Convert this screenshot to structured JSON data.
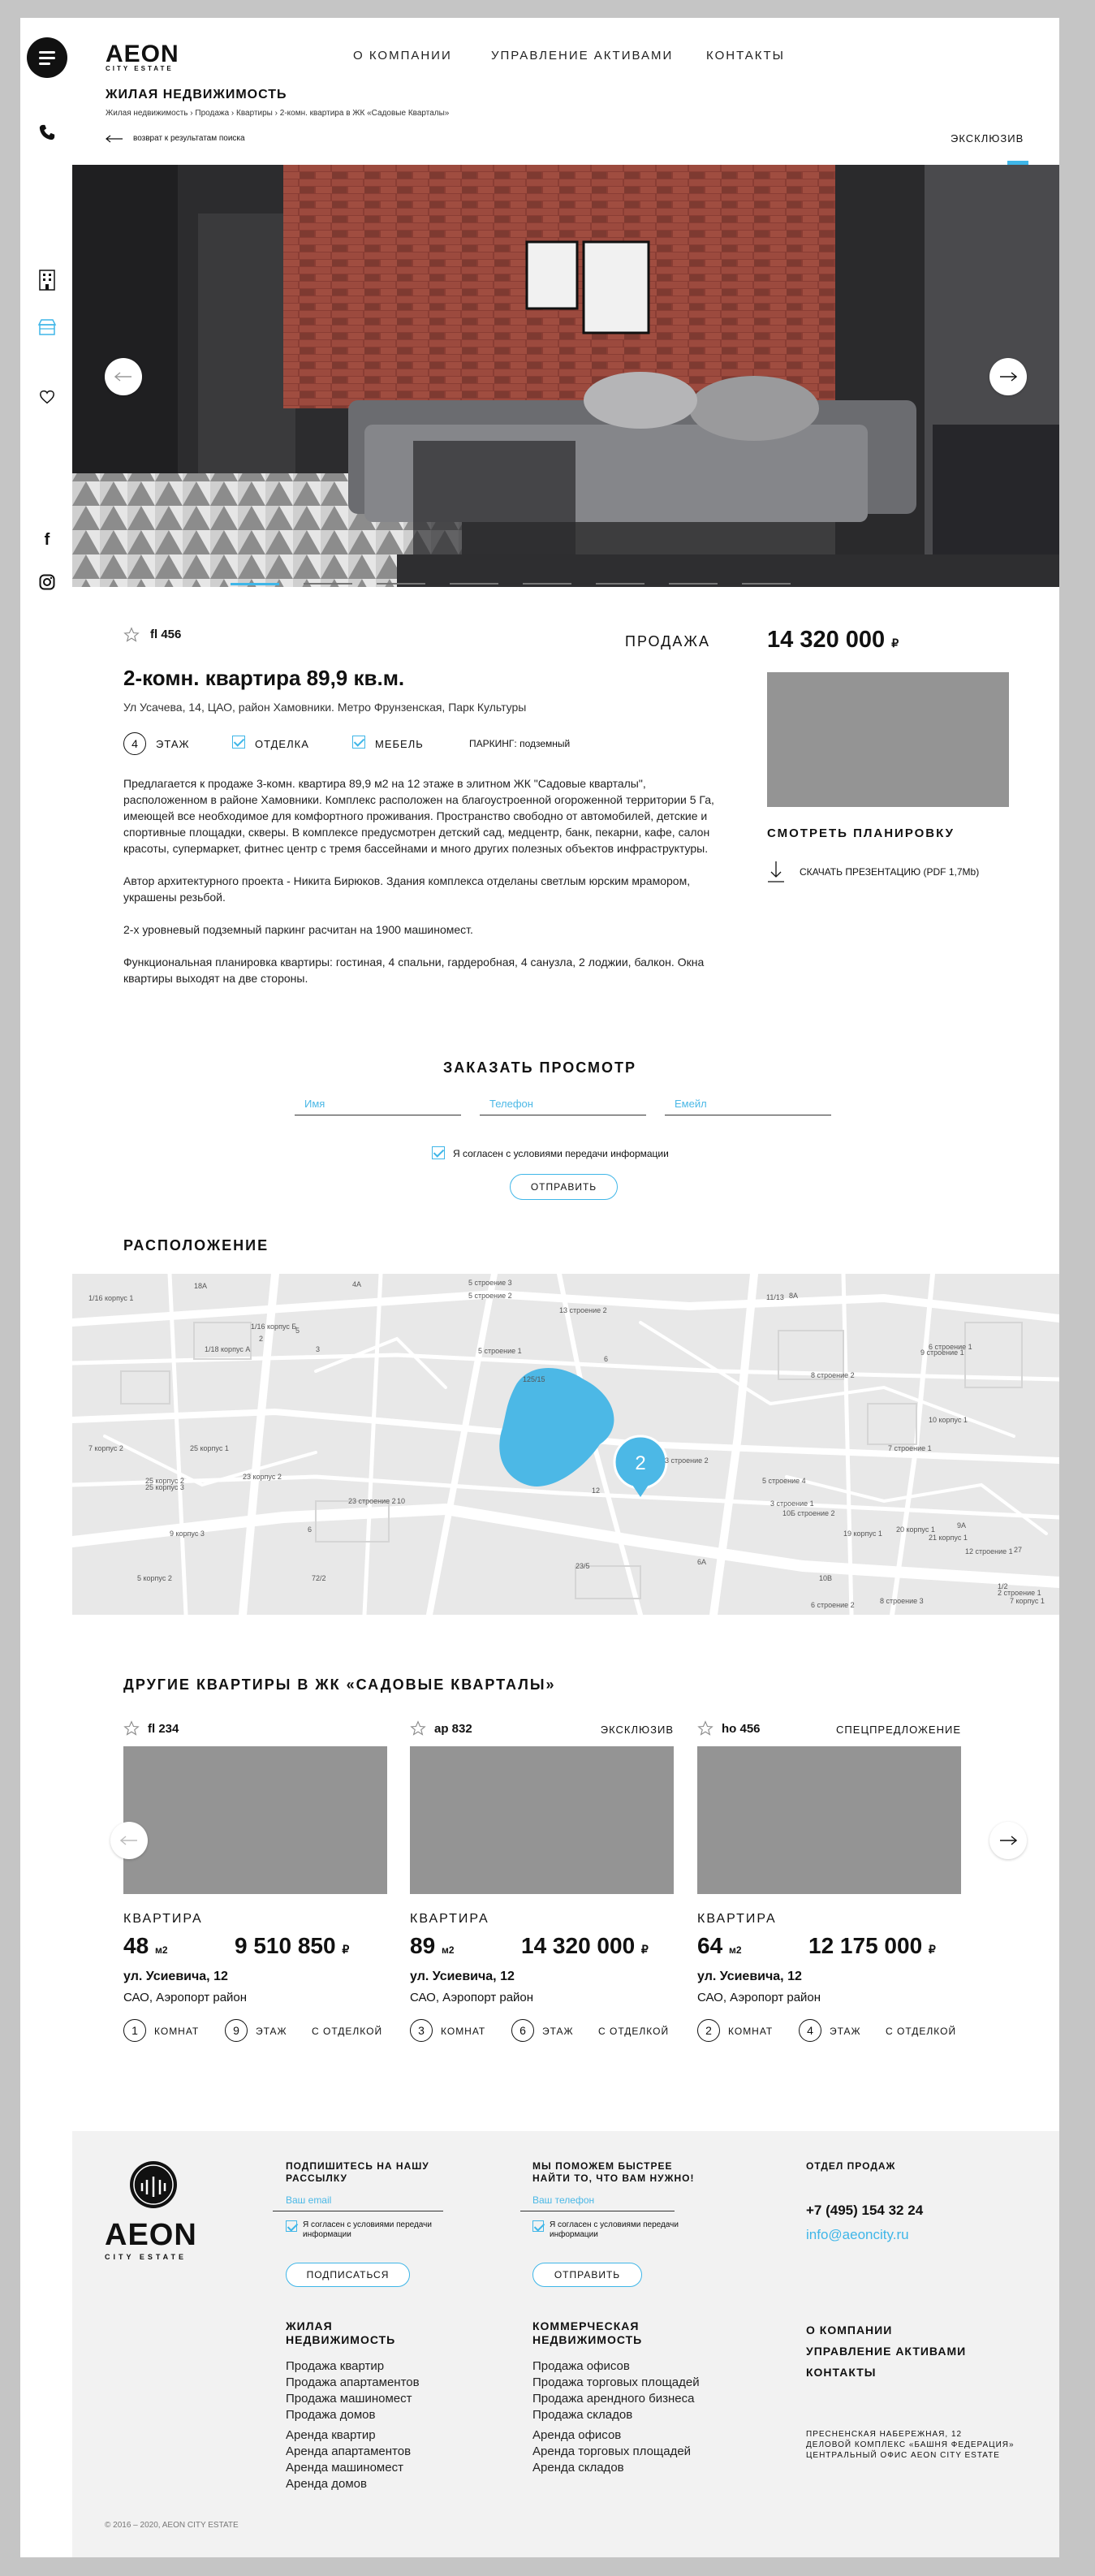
{
  "header": {
    "logo": "AEON",
    "logo_sub": "CITY ESTATE",
    "nav": [
      "О КОМПАНИИ",
      "УПРАВЛЕНИЕ АКТИВАМИ",
      "КОНТАКТЫ"
    ]
  },
  "page": {
    "title": "ЖИЛАЯ НЕДВИЖИМОСТЬ",
    "breadcrumb": "Жилая недвижимость › Продажа › Квартиры › 2-комн. квартира в ЖК «Садовые Кварталы»",
    "back_link": "возврат к результатам поиска",
    "exclusive": "ЭКСКЛЮЗИВ"
  },
  "listing": {
    "id": "fl 456",
    "deal": "ПРОДАЖА",
    "price": "14 320 000",
    "currency": "₽",
    "title": "2-комн. квартира 89,9 кв.м.",
    "address": "Ул Усачева, 14, ЦАО, район Хамовники. Метро Фрунзенская, Парк Культуры",
    "floor_num": "4",
    "floor_label": "ЭТАЖ",
    "finish_label": "ОТДЕЛКА",
    "furniture_label": "МЕБЕЛЬ",
    "parking": "ПАРКИНГ: подземный",
    "desc_1": "Предлагается к продаже 3-комн. квартира 89,9 м2 на 12 этаже в элитном ЖК \"Садовые кварталы\", расположенном в районе Хамовники. Комплекс расположен на благоустроенной огороженной территории 5 Га, имеющей все необходимое для комфортного проживания. Пространство свободно от автомобилей, детские и спортивные площадки, скверы. В комплексе предусмотрен детский сад, медцентр, банк, пекарни, кафе, салон красоты, супермаркет, фитнес центр с тремя бассейнами и много других полезных объектов инфраструктуры.",
    "desc_2": "Автор архитектурного проекта - Никита Бирюков. Здания комплекса отделаны светлым юрским мрамором, украшены резьбой.",
    "desc_3": "2-х уровневый подземный паркинг расчитан на 1900 машиномест.",
    "desc_4": "Функциональная планировка квартиры: гостиная, 4 спальни, гардеробная, 4 санузла, 2 лоджии, балкон. Окна квартиры выходят на две стороны.",
    "plan_label": "СМОТРЕТЬ ПЛАНИРОВКУ",
    "download_label": "СКАЧАТЬ ПРЕЗЕНТАЦИЮ (PDF 1,7Mb)"
  },
  "booking": {
    "title": "ЗАКАЗАТЬ ПРОСМОТР",
    "name_placeholder": "Имя",
    "phone_placeholder": "Телефон",
    "email_placeholder": "Емейл",
    "consent": "Я согласен с  условиями передачи информации",
    "submit": "ОТПРАВИТЬ"
  },
  "location": {
    "title": "РАСПОЛОЖЕНИЕ",
    "marker_count": "2"
  },
  "map_labels": [
    "18А",
    "4А",
    "5 строение 3",
    "5 строение 2",
    "13 строение 2",
    "11/13",
    "8А",
    "1/16 корпус 1",
    "1/16 корпус Б",
    "2",
    "5",
    "3",
    "1/18 корпус А",
    "5 строение 1",
    "125/15",
    "6",
    "8 строение 2",
    "6 строение 1",
    "9 строение 1",
    "10 корпус 1",
    "7 корпус 2",
    "25 корпус 1",
    "25 корпус 2",
    "25 корпус 3",
    "23 корпус 2",
    "23 строение 2",
    "10",
    "12",
    "3 строение 2",
    "5 строение 4",
    "7 строение 1",
    "10Б строение 2",
    "3 строение 1",
    "20 корпус 1",
    "19 корпус 1",
    "21 корпус 1",
    "12 строение 1",
    "9А",
    "27",
    "6",
    "9 корпус 3",
    "5 корпус 2",
    "72/2",
    "23/5",
    "6А",
    "10В",
    "1/2",
    "2 строение 1",
    "8 строение 3",
    "6 строение 2",
    "7 корпус 1"
  ],
  "others": {
    "title": "ДРУГИЕ КВАРТИРЫ В ЖК «САДОВЫЕ КВАРТАЛЫ»",
    "cards": [
      {
        "id": "fl 234",
        "tag": "",
        "type": "КВАРТИРА",
        "area": "48",
        "area_unit": "м2",
        "price": "9 510 850",
        "currency": "₽",
        "street": "ул. Усиевича, 12",
        "district": "САО, Аэропорт район",
        "rooms": "1",
        "rooms_label": "КОМНАТ",
        "floor": "9",
        "floor_label": "ЭТАЖ",
        "finish": "С ОТДЕЛКОЙ"
      },
      {
        "id": "ap 832",
        "tag": "ЭКСКЛЮЗИВ",
        "type": "КВАРТИРА",
        "area": "89",
        "area_unit": "м2",
        "price": "14 320 000",
        "currency": "₽",
        "street": "ул. Усиевича, 12",
        "district": "САО, Аэропорт район",
        "rooms": "3",
        "rooms_label": "КОМНАТ",
        "floor": "6",
        "floor_label": "ЭТАЖ",
        "finish": "С ОТДЕЛКОЙ"
      },
      {
        "id": "ho 456",
        "tag": "СПЕЦПРЕДЛОЖЕНИЕ",
        "type": "КВАРТИРА",
        "area": "64",
        "area_unit": "м2",
        "price": "12 175 000",
        "currency": "₽",
        "street": "ул. Усиевича, 12",
        "district": "САО, Аэропорт район",
        "rooms": "2",
        "rooms_label": "КОМНАТ",
        "floor": "4",
        "floor_label": "ЭТАЖ",
        "finish": "С ОТДЕЛКОЙ"
      }
    ]
  },
  "footer": {
    "logo": "AEON",
    "logo_sub": "CITY ESTATE",
    "subscribe_title": "ПОДПИШИТЕСЬ НА НАШУ РАССЫЛКУ",
    "subscribe_placeholder": "Ваш email",
    "consent": "Я согласен с  условиями передачи информации",
    "subscribe_button": "ПОДПИСАТЬСЯ",
    "help_title": "МЫ ПОМОЖЕМ БЫСТРЕЕ  НАЙТИ ТО, ЧТО ВАМ НУЖНО!",
    "phone_placeholder": "Ваш телефон",
    "help_button": "ОТПРАВИТЬ",
    "sales_title": "ОТДЕЛ ПРОДАЖ",
    "sales_phone": "+7 (495) 154 32 24",
    "sales_email": "info@aeoncity.ru",
    "residential_title": "ЖИЛАЯ НЕДВИЖИМОСТЬ",
    "residential_links": [
      "Продажа квартир",
      "Продажа апартаментов",
      "Продажа машиномест",
      "Продажа домов"
    ],
    "residential_links_2": [
      "Аренда квартир",
      "Аренда апартаментов",
      "Аренда машиномест",
      "Аренда домов"
    ],
    "commercial_title": "КОММЕРЧЕСКАЯ НЕДВИЖИМОСТЬ",
    "commercial_links": [
      "Продажа офисов",
      "Продажа торговых площадей",
      "Продажа арендного бизнеса",
      "Продажа складов"
    ],
    "commercial_links_2": [
      "Аренда офисов",
      "Аренда торговых площадей",
      "Аренда складов"
    ],
    "menu": [
      "О КОМПАНИИ",
      "УПРАВЛЕНИЕ АКТИВАМИ",
      "КОНТАКТЫ"
    ],
    "address_1": "ПРЕСНЕНСКАЯ НАБЕРЕЖНАЯ, 12",
    "address_2": "ДЕЛОВОЙ КОМПЛЕКС «БАШНЯ ФЕДЕРАЦИЯ»",
    "address_3": "ЦЕНТРАЛЬНЫЙ ОФИС AEON CITY ESTATE",
    "copyright": "© 2016 – 2020, AEON CITY ESTATE"
  },
  "colors": {
    "accent": "#3fb6e8",
    "placeholder": "#949494",
    "footer_bg": "#f2f2f2"
  }
}
